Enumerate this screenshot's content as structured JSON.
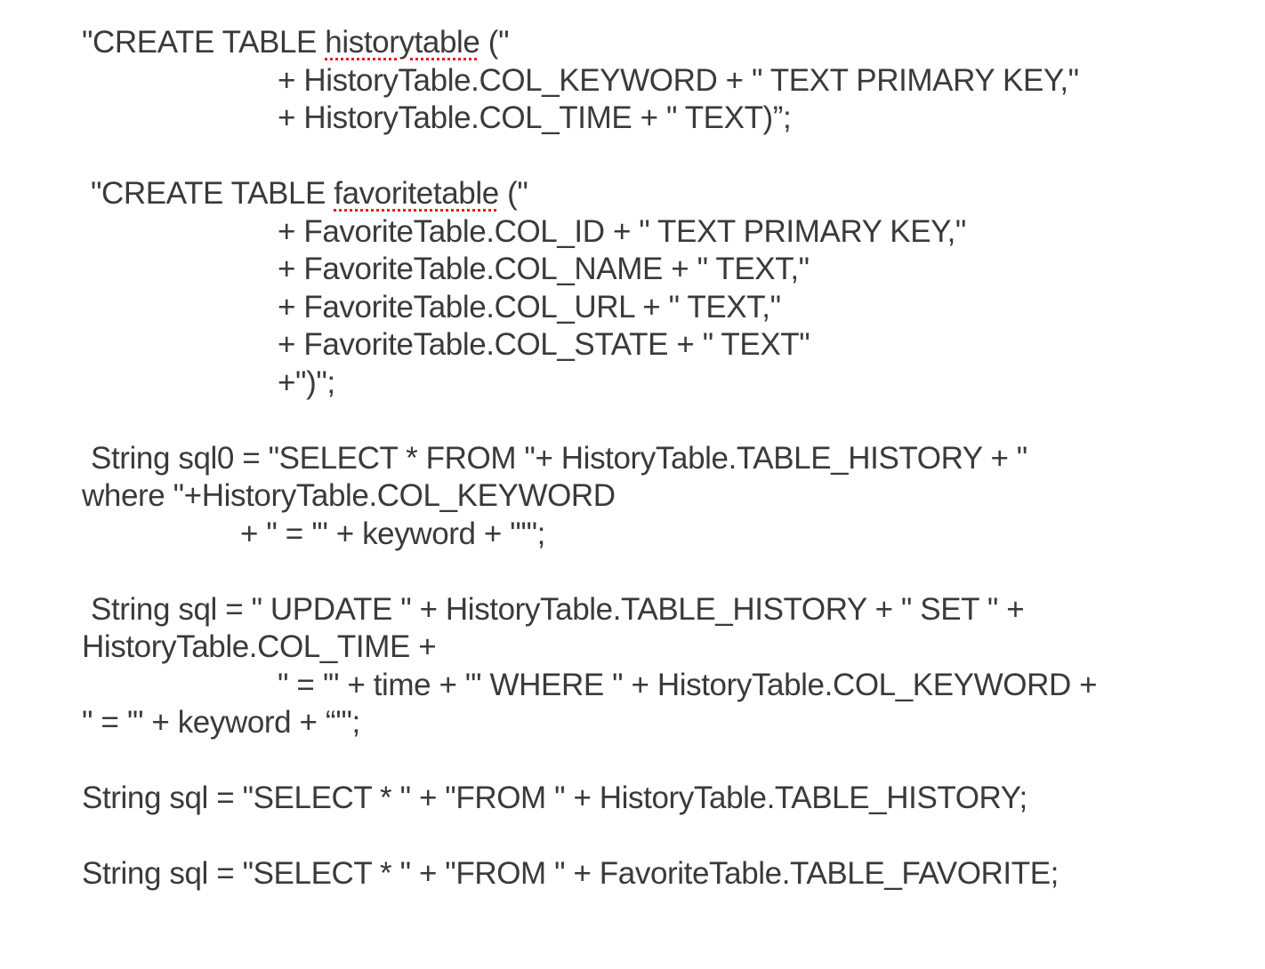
{
  "history_create": {
    "prefix": "\"CREATE TABLE ",
    "table_word": "historytable",
    "suffix": " (\"",
    "line2": "+ HistoryTable.COL_KEYWORD + \" TEXT PRIMARY KEY,\"",
    "line3": "+ HistoryTable.COL_TIME + \" TEXT)”;"
  },
  "favorite_create": {
    "prefix": "\"CREATE TABLE ",
    "table_word": "favoritetable",
    "suffix": " (\"",
    "line2": "+ FavoriteTable.COL_ID + \" TEXT PRIMARY KEY,\"",
    "line3": "+ FavoriteTable.COL_NAME + \" TEXT,\"",
    "line4": "+ FavoriteTable.COL_URL + \" TEXT,\"",
    "line5": "+ FavoriteTable.COL_STATE + \" TEXT\"",
    "line6": "+\")\";"
  },
  "select_keyword": {
    "line1": "String sql0 = \"SELECT * FROM \"+ HistoryTable.TABLE_HISTORY + \"",
    "line2": "where \"+HistoryTable.COL_KEYWORD",
    "line3": "+ \" = '\" + keyword + \"'\";"
  },
  "update_time": {
    "line1": "String sql = \" UPDATE \" + HistoryTable.TABLE_HISTORY + \" SET \" +",
    "line2": "HistoryTable.COL_TIME +",
    "line3": "\" = '\" + time + \"' WHERE \" + HistoryTable.COL_KEYWORD +",
    "line4": "\" = '\" + keyword + “'\";"
  },
  "select_history": "String sql = \"SELECT * \" + \"FROM \" + HistoryTable.TABLE_HISTORY;",
  "select_favorite": "String sql = \"SELECT * \" + \"FROM \" + FavoriteTable.TABLE_FAVORITE;"
}
